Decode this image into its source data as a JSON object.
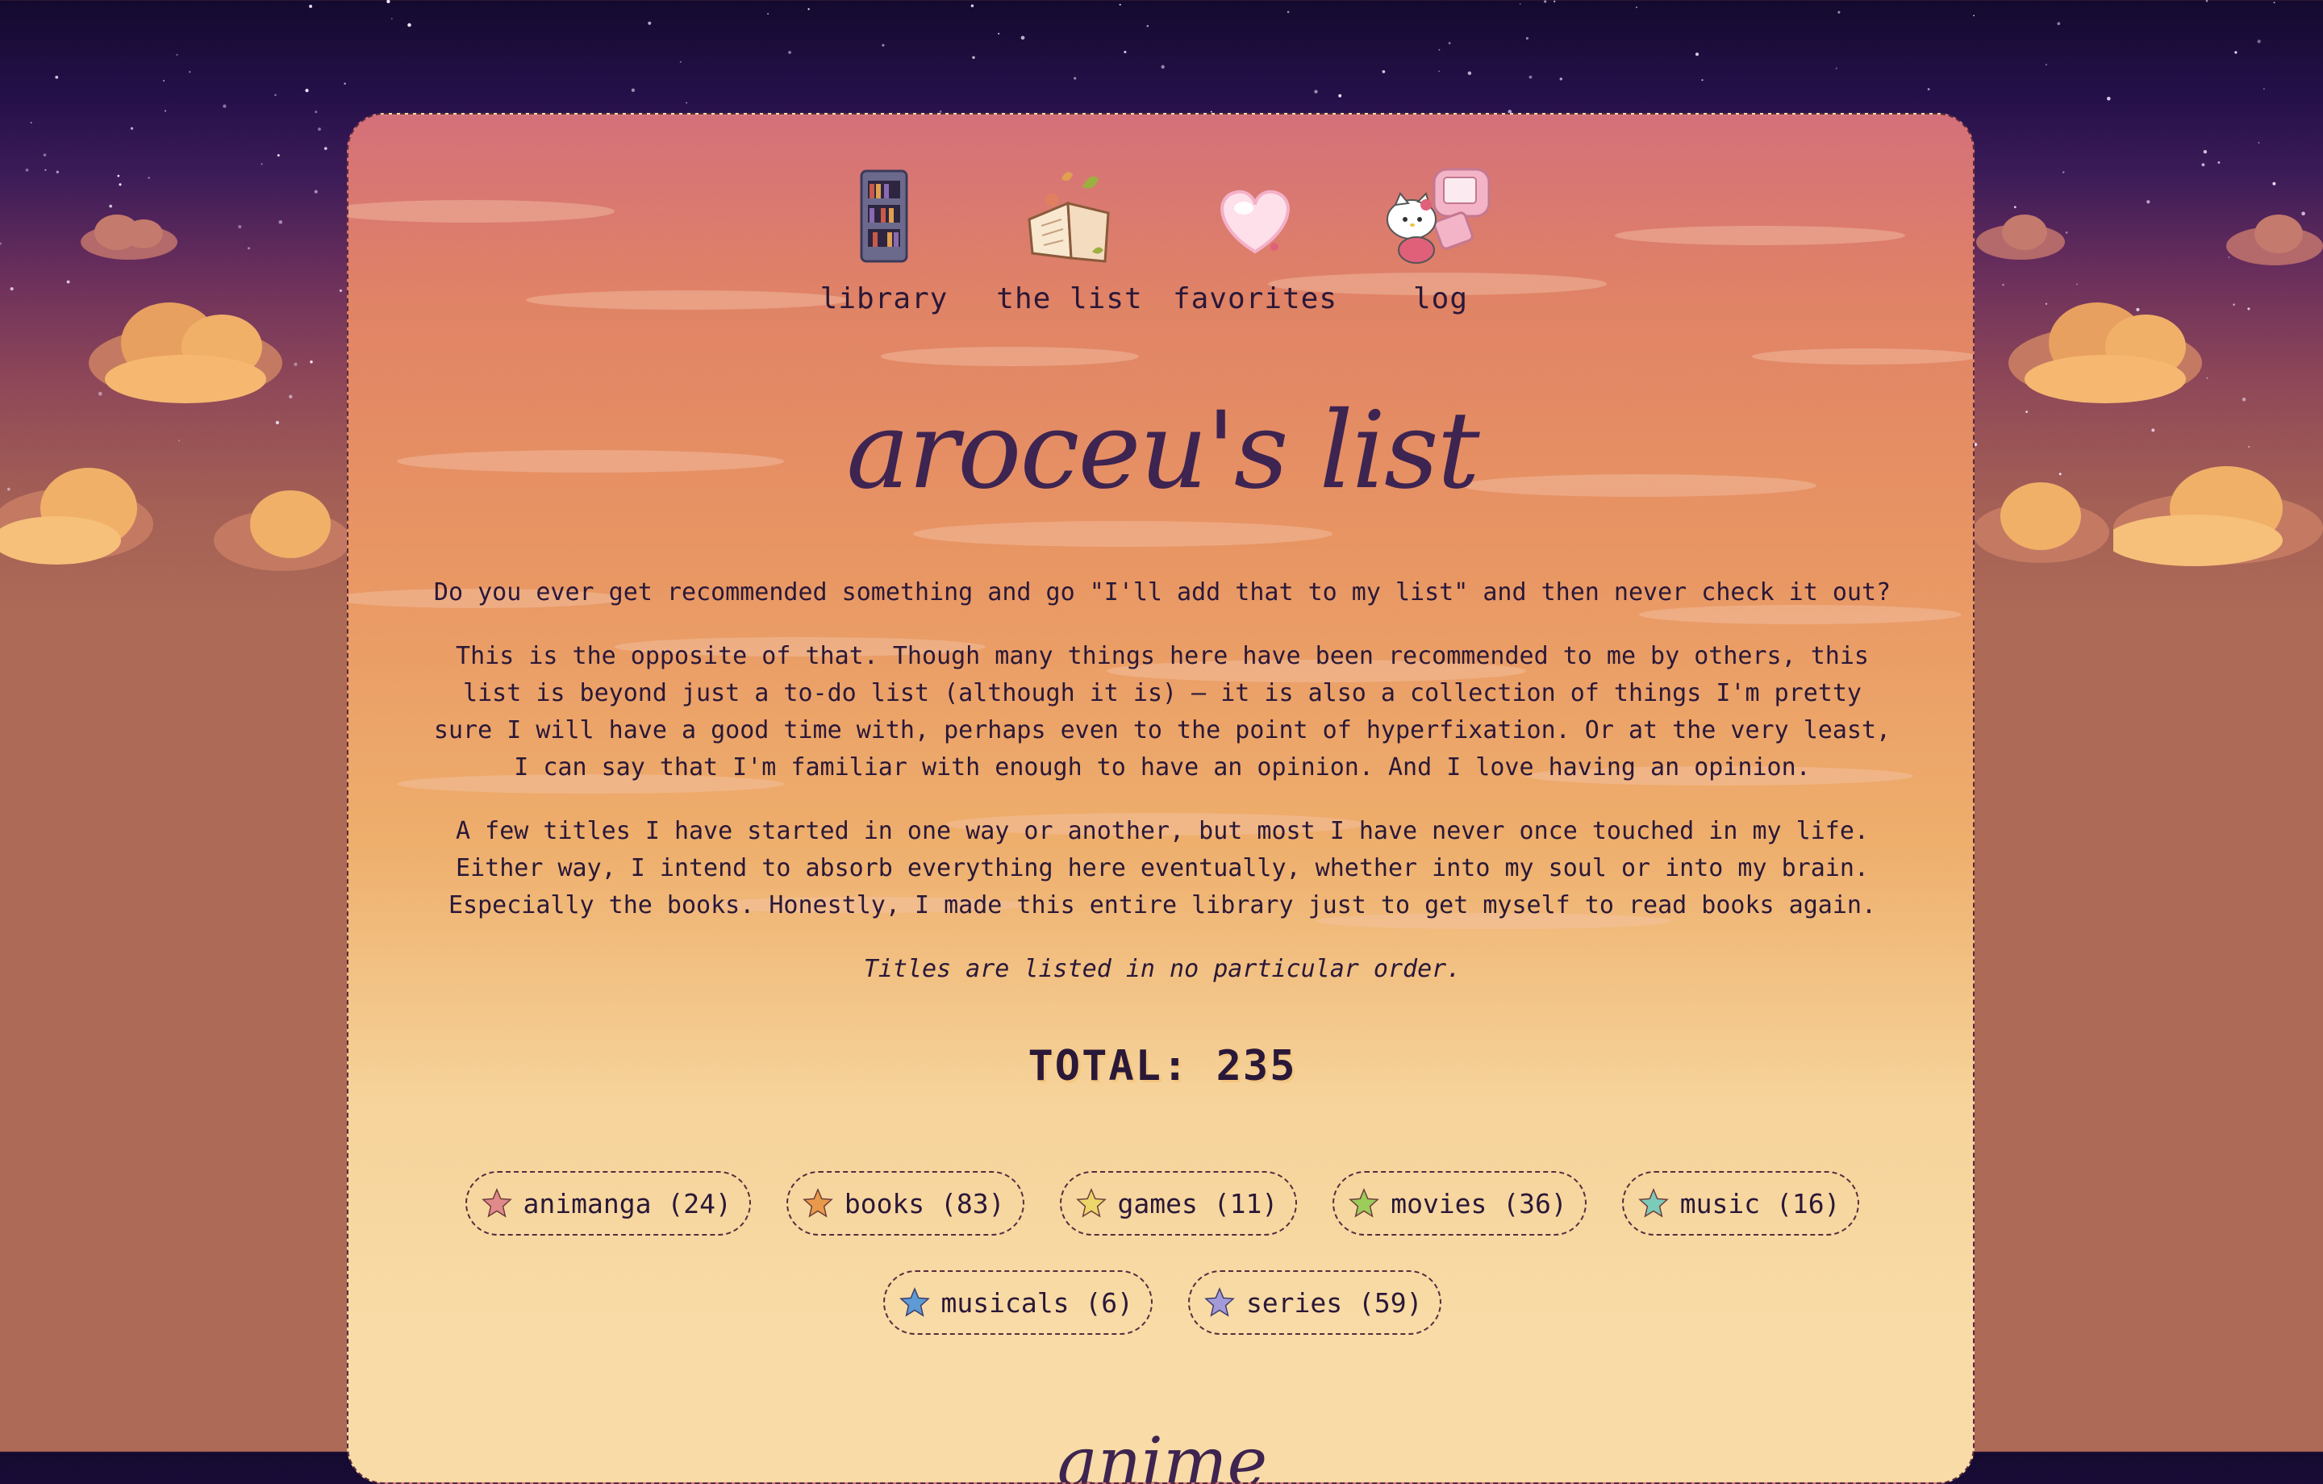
{
  "nav": [
    {
      "label": "library",
      "icon": "bookshelf-icon"
    },
    {
      "label": "the list",
      "icon": "open-book-icon"
    },
    {
      "label": "favorites",
      "icon": "heart-icon"
    },
    {
      "label": "log",
      "icon": "hello-kitty-computer-icon"
    }
  ],
  "page_title": "aroceu's list",
  "intro": [
    "Do you ever get recommended something and go \"I'll add that to my list\" and then never check it out?",
    "This is the opposite of that. Though many things here have been recommended to me by others, this list is beyond just a to-do list (although it is) — it is also a collection of things I'm pretty sure I will have a good time with, perhaps even to the point of hyperfixation. Or at the very least, I can say that I'm familiar with enough to have an opinion. And I love having an opinion.",
    "A few titles I have started in one way or another, but most I have never once touched in my life. Either way, I intend to absorb everything here eventually, whether into my soul or into my brain. Especially the books. Honestly, I made this entire library just to get myself to read books again."
  ],
  "order_note": "Titles are listed in no particular order.",
  "total": "TOTAL: 235",
  "categories": [
    {
      "label": "animanga (24)",
      "icon": "star-icon",
      "color": "#e08a8a"
    },
    {
      "label": "books (83)",
      "icon": "star-icon",
      "color": "#e89a4a"
    },
    {
      "label": "games (11)",
      "icon": "star-icon",
      "color": "#ecd66a"
    },
    {
      "label": "movies (36)",
      "icon": "star-icon",
      "color": "#9ccc5a"
    },
    {
      "label": "music (16)",
      "icon": "star-icon",
      "color": "#7ccab8"
    },
    {
      "label": "musicals (6)",
      "icon": "star-icon",
      "color": "#5e9ad4"
    },
    {
      "label": "series (59)",
      "icon": "star-icon",
      "color": "#a49ad8"
    }
  ],
  "next_section_heading": "anime"
}
